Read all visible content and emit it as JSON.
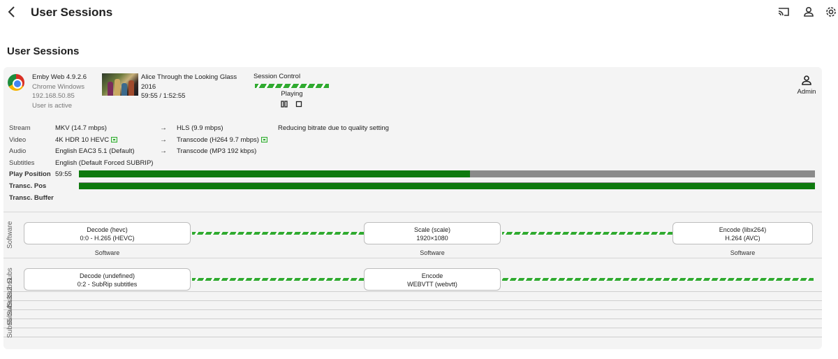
{
  "header": {
    "title": "User Sessions"
  },
  "section": {
    "title": "User Sessions"
  },
  "session": {
    "client": {
      "app": "Emby Web 4.9.2.6",
      "device": "Chrome Windows",
      "ip": "192.168.50.85",
      "status": "User is active"
    },
    "media": {
      "title": "Alice Through the Looking Glass",
      "year": "2016",
      "position": "59:55 / 1:52:55"
    },
    "control": {
      "label": "Session Control",
      "state": "Playing"
    },
    "user": {
      "name": "Admin"
    }
  },
  "stats": {
    "stream": {
      "label": "Stream",
      "source": "MKV (14.7 mbps)",
      "target": "HLS (9.9 mbps)",
      "note": "Reducing bitrate due to quality setting"
    },
    "video": {
      "label": "Video",
      "source": "4K HDR 10 HEVC",
      "target": "Transcode (H264 9.7 mbps)"
    },
    "audio": {
      "label": "Audio",
      "source": "English EAC3 5.1 (Default)",
      "target": "Transcode (MP3 192 kbps)"
    },
    "subtitles": {
      "label": "Subtitles",
      "source": "English (Default Forced SUBRIP)"
    },
    "play_position": {
      "label": "Play Position",
      "value": "59:55",
      "fraction": 0.531
    },
    "transc_pos": {
      "label": "Transc. Pos",
      "fraction": 1.0
    },
    "transc_buffer": {
      "label": "Transc. Buffer"
    },
    "arrow": "→"
  },
  "pipeline": {
    "software": {
      "label": "Software",
      "nodes": [
        {
          "title": "Decode (hevc)",
          "detail": "0:0 - H.265 (HEVC)",
          "sub": "Software"
        },
        {
          "title": "Scale (scale)",
          "detail": "1920×1080",
          "sub": "Software"
        },
        {
          "title": "Encode (libx264)",
          "detail": "H.264 (AVC)",
          "sub": "Software"
        }
      ]
    },
    "subs": {
      "label": "Subs",
      "nodes": [
        {
          "title": "Decode (undefined)",
          "detail": "0:2 - SubRip subtitles"
        },
        {
          "title": "Encode",
          "detail": "WEBVTT (webvtt)"
        }
      ]
    },
    "extra_lanes": [
      "Subs1",
      "Subs2",
      "Subs3",
      "Subs4",
      "Subs5"
    ]
  },
  "colors": {
    "accent_green": "#2faa2f",
    "progress_green": "#0e7a0e",
    "track_gray": "#8a8a8a"
  },
  "icons": {
    "back": "chevron-left-icon",
    "cast": "cast-icon",
    "user": "user-icon",
    "settings": "gear-icon",
    "pause": "pause-icon",
    "stop": "stop-icon",
    "hardware": "chip-icon"
  }
}
